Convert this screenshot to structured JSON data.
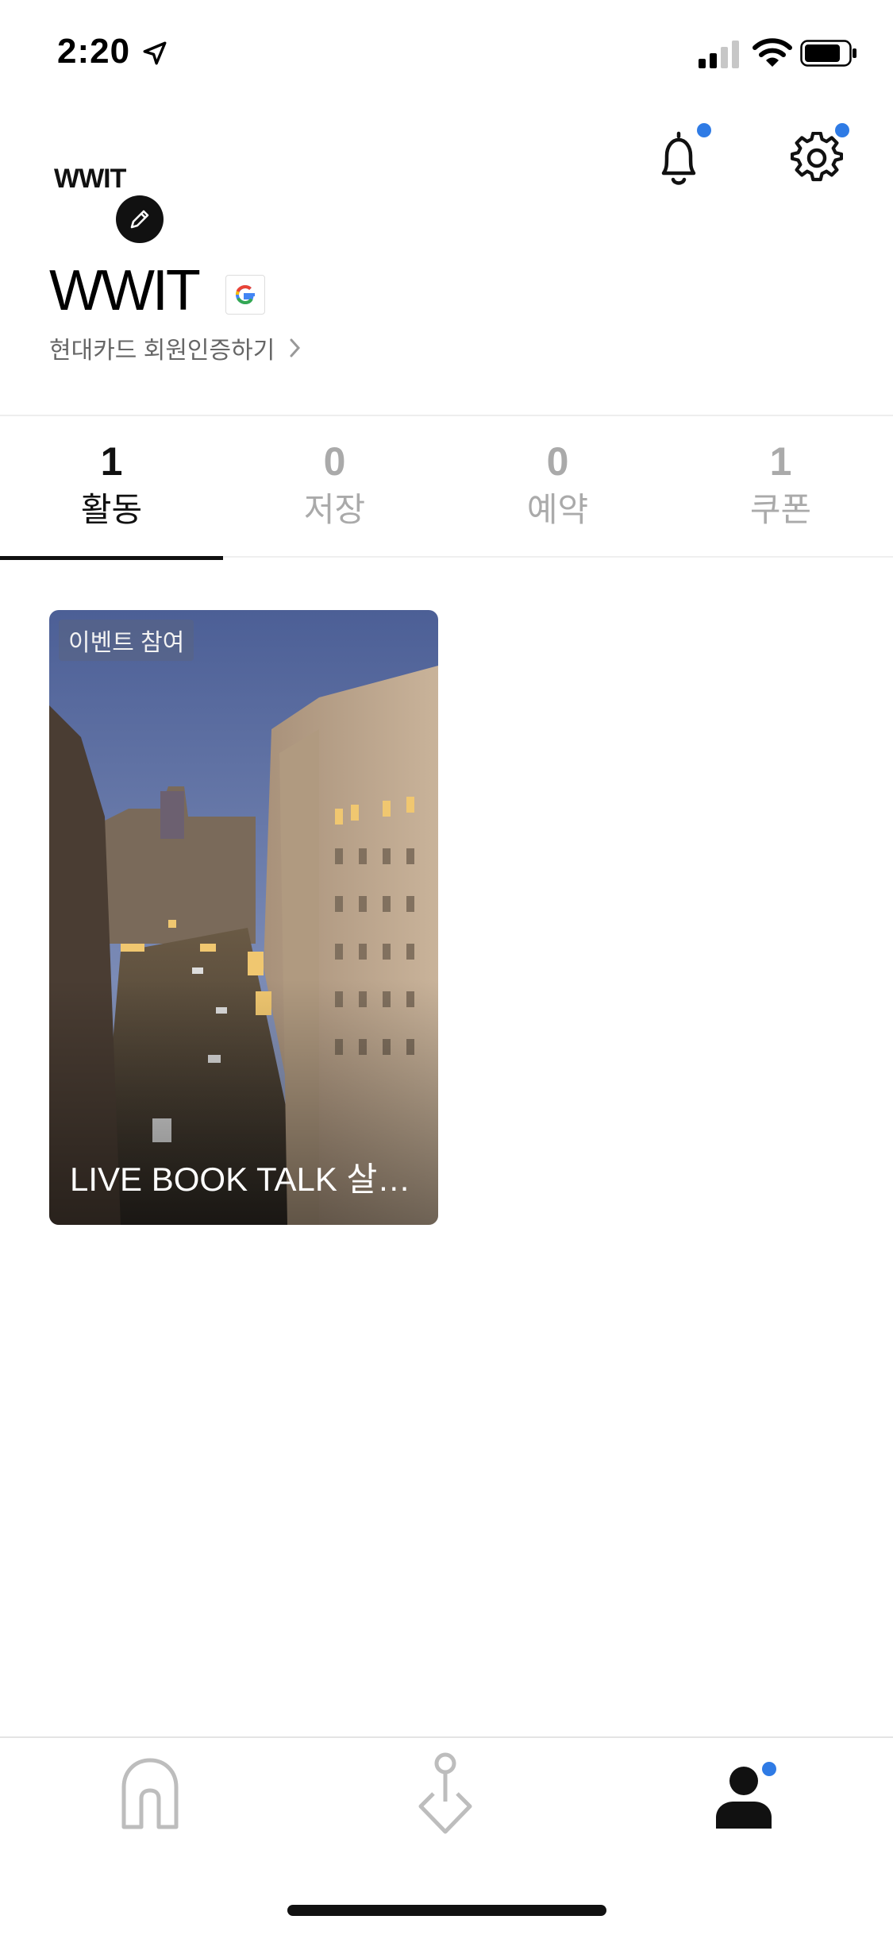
{
  "status_bar": {
    "time": "2:20"
  },
  "profile": {
    "logo_text": "WWIT",
    "username": "WWIT",
    "card_auth_link": "현대카드 회원인증하기"
  },
  "tabs": [
    {
      "count": "1",
      "label": "활동",
      "active": true
    },
    {
      "count": "0",
      "label": "저장",
      "active": false
    },
    {
      "count": "0",
      "label": "예약",
      "active": false
    },
    {
      "count": "1",
      "label": "쿠폰",
      "active": false
    }
  ],
  "activity": [
    {
      "badge": "이벤트 참여",
      "title": "LIVE BOOK TALK 살…"
    }
  ],
  "colors": {
    "accent_dot": "#2f7be5",
    "text_primary": "#111111",
    "text_inactive": "#aaaaaa"
  },
  "icons": {
    "header": [
      "bell-icon",
      "gear-icon"
    ],
    "bottom_nav": [
      "home-icon",
      "location-pin-icon",
      "user-icon"
    ]
  }
}
